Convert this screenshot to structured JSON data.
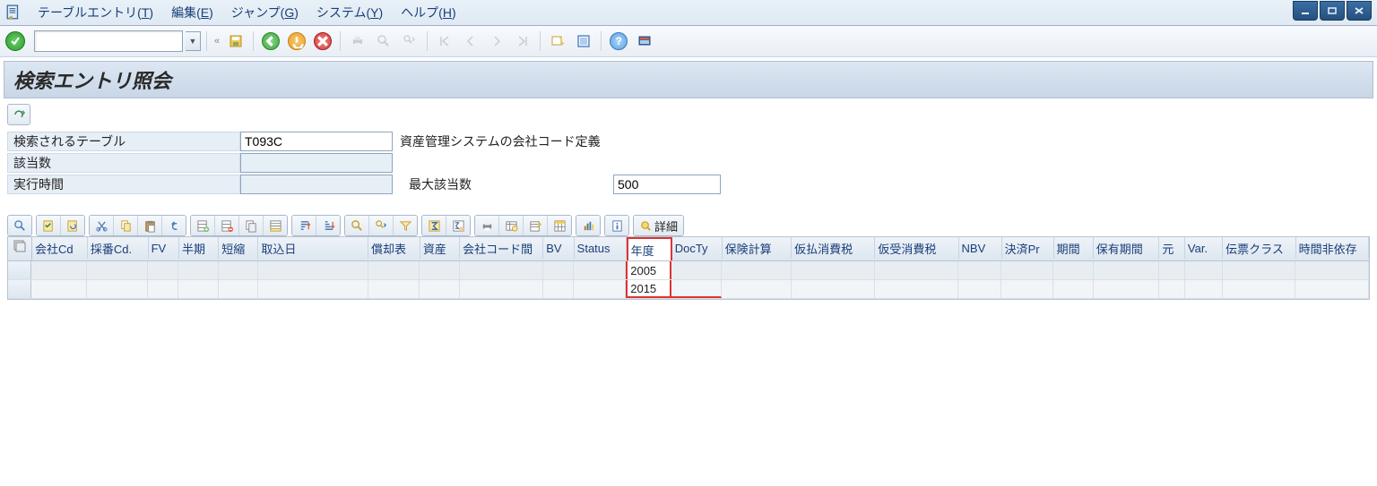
{
  "menu": {
    "items": [
      {
        "label": "テーブルエントリ",
        "key": "T"
      },
      {
        "label": "編集",
        "key": "E"
      },
      {
        "label": "ジャンプ",
        "key": "G"
      },
      {
        "label": "システム",
        "key": "Y"
      },
      {
        "label": "ヘルプ",
        "key": "H"
      }
    ]
  },
  "std_toolbar": {
    "command_value": ""
  },
  "title": "検索エントリ照会",
  "form": {
    "table_label": "検索されるテーブル",
    "table_value": "T093C",
    "table_desc": "資産管理システムの会社コード定義",
    "hits_label": "該当数",
    "hits_value": "",
    "runtime_label": "実行時間",
    "runtime_value": "",
    "maxhits_label": "最大該当数",
    "maxhits_value": "500"
  },
  "alv_detail_label": "詳細",
  "grid": {
    "columns": [
      "会社Cd",
      "採番Cd.",
      "FV",
      "半期",
      "短縮",
      "取込日",
      "償却表",
      "資産",
      "会社コード間",
      "BV",
      "Status",
      "年度",
      "DocTy",
      "保険計算",
      "仮払消費税",
      "仮受消費税",
      "NBV",
      "決済Pr",
      "期間",
      "保有期間",
      "元",
      "Var.",
      "伝票クラス",
      "時間非依存"
    ],
    "rows": [
      {
        "year": "2005"
      },
      {
        "year": "2015"
      }
    ]
  }
}
